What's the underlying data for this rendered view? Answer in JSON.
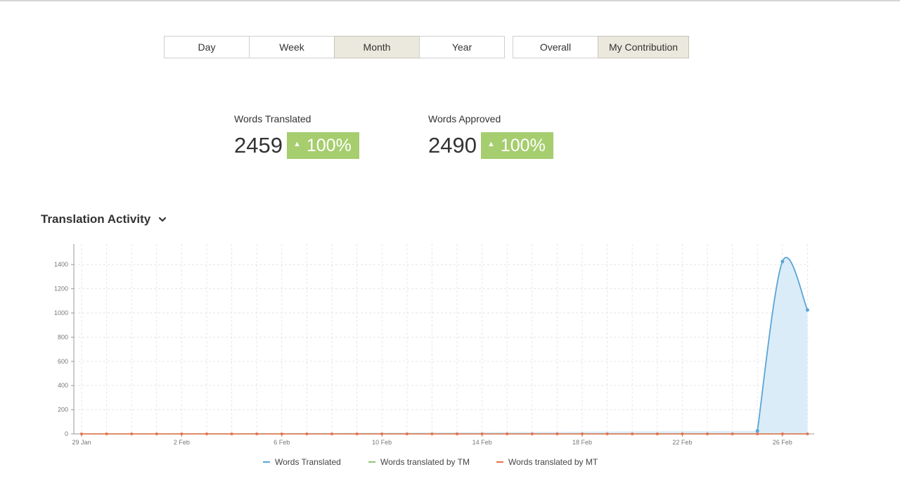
{
  "filters": {
    "period": [
      {
        "label": "Day",
        "active": false
      },
      {
        "label": "Week",
        "active": false
      },
      {
        "label": "Month",
        "active": true
      },
      {
        "label": "Year",
        "active": false
      }
    ],
    "scope": [
      {
        "label": "Overall",
        "active": false
      },
      {
        "label": "My Contribution",
        "active": true
      }
    ]
  },
  "stats": {
    "translated": {
      "label": "Words Translated",
      "value": "2459",
      "change": "100%",
      "trend_icon": "triangle-up-icon"
    },
    "approved": {
      "label": "Words Approved",
      "value": "2490",
      "change": "100%",
      "trend_icon": "triangle-up-icon"
    }
  },
  "section": {
    "title": "Translation Activity",
    "toggle_icon": "chevron-down-icon"
  },
  "colors": {
    "active_button": "#ebe8de",
    "badge": "#a6cd6e",
    "series_translated": "#5aa5d6",
    "series_translated_fill": "#d7eaf8",
    "series_tm": "#8cc97b",
    "series_mt": "#e5734e"
  },
  "chart_data": {
    "type": "area",
    "x_dates": [
      "29 Jan",
      "30 Jan",
      "31 Jan",
      "1 Feb",
      "2 Feb",
      "3 Feb",
      "4 Feb",
      "5 Feb",
      "6 Feb",
      "7 Feb",
      "8 Feb",
      "9 Feb",
      "10 Feb",
      "11 Feb",
      "12 Feb",
      "13 Feb",
      "14 Feb",
      "15 Feb",
      "16 Feb",
      "17 Feb",
      "18 Feb",
      "19 Feb",
      "20 Feb",
      "21 Feb",
      "22 Feb",
      "23 Feb",
      "24 Feb",
      "25 Feb",
      "26 Feb",
      "27 Feb"
    ],
    "x_tick_labels": [
      "29 Jan",
      "2 Feb",
      "6 Feb",
      "10 Feb",
      "14 Feb",
      "18 Feb",
      "22 Feb",
      "26 Feb"
    ],
    "y_ticks": [
      0,
      200,
      400,
      600,
      800,
      1000,
      1200,
      1400
    ],
    "ylim": [
      0,
      1570
    ],
    "grid": true,
    "legend_position": "bottom",
    "series": [
      {
        "name": "Words Translated",
        "values": [
          0,
          0,
          0,
          0,
          0,
          0,
          0,
          0,
          0,
          0,
          0,
          0,
          0,
          0,
          0,
          0,
          0,
          0,
          0,
          0,
          0,
          0,
          0,
          0,
          0,
          0,
          0,
          25,
          1425,
          1025
        ]
      },
      {
        "name": "Words translated by TM",
        "values": [
          0,
          0,
          0,
          0,
          0,
          0,
          0,
          0,
          0,
          0,
          0,
          0,
          0,
          0,
          0,
          0,
          0,
          0,
          0,
          0,
          0,
          0,
          0,
          0,
          0,
          0,
          0,
          0,
          0,
          0
        ]
      },
      {
        "name": "Words translated by MT",
        "values": [
          0,
          0,
          0,
          0,
          0,
          0,
          0,
          0,
          0,
          0,
          0,
          0,
          0,
          0,
          0,
          0,
          0,
          0,
          0,
          0,
          0,
          0,
          0,
          0,
          0,
          0,
          0,
          0,
          0,
          0
        ]
      }
    ]
  }
}
